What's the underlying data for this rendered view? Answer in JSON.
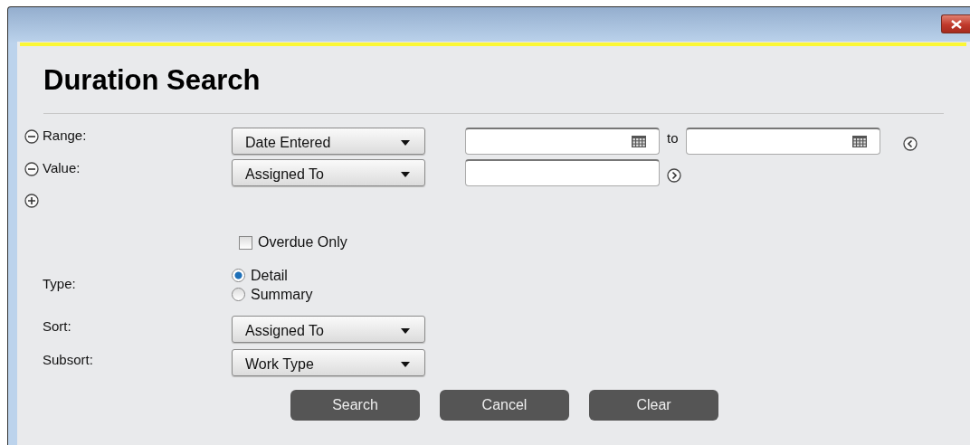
{
  "heading": "Duration Search",
  "criteria": [
    {
      "kind": "range",
      "label": "Range:",
      "field": "Date Entered",
      "connector": "to"
    },
    {
      "kind": "value",
      "label": "Value:",
      "field": "Assigned To"
    }
  ],
  "overdue": {
    "label": "Overdue Only",
    "checked": false
  },
  "type": {
    "label": "Type:",
    "options": [
      {
        "label": "Detail",
        "selected": true
      },
      {
        "label": "Summary",
        "selected": false
      }
    ]
  },
  "sorts": [
    {
      "label": "Sort:",
      "value": "Assigned To"
    },
    {
      "label": "Subsort:",
      "value": "Work Type"
    }
  ],
  "buttons": [
    "Search",
    "Cancel",
    "Clear"
  ]
}
